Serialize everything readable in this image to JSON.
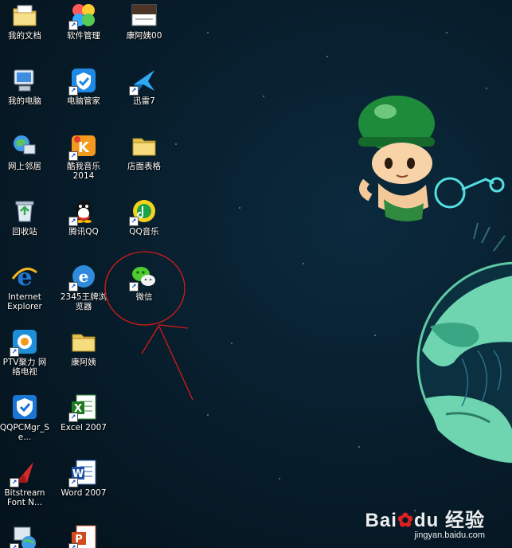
{
  "desktop": {
    "icons": [
      {
        "label": "我的文档",
        "icon": "my-documents-folder-icon",
        "shortcut": false
      },
      {
        "label": "软件管理",
        "icon": "software-manager-icon",
        "shortcut": true
      },
      {
        "label": "康阿姨00",
        "icon": "document-thumbnail-icon",
        "shortcut": false
      },
      {
        "label": "我的电脑",
        "icon": "my-computer-icon",
        "shortcut": false
      },
      {
        "label": "电脑管家",
        "icon": "pc-manager-shield-icon",
        "shortcut": true
      },
      {
        "label": "迅雷7",
        "icon": "xunlei-bird-icon",
        "shortcut": true
      },
      {
        "label": "网上邻居",
        "icon": "network-places-icon",
        "shortcut": false
      },
      {
        "label": "酷我音乐\n2014",
        "icon": "kuwo-music-icon",
        "shortcut": true
      },
      {
        "label": "店面表格",
        "icon": "folder-icon",
        "shortcut": false
      },
      {
        "label": "回收站",
        "icon": "recycle-bin-icon",
        "shortcut": false
      },
      {
        "label": "腾讯QQ",
        "icon": "qq-penguin-icon",
        "shortcut": true
      },
      {
        "label": "QQ音乐",
        "icon": "qq-music-icon",
        "shortcut": true
      },
      {
        "label": "Internet\nExplorer",
        "icon": "internet-explorer-icon",
        "shortcut": false
      },
      {
        "label": "2345王牌浏\n览器",
        "icon": "browser-2345-icon",
        "shortcut": true
      },
      {
        "label": "微信",
        "icon": "wechat-icon",
        "shortcut": true
      },
      {
        "label": "PTV聚力 网\n络电视",
        "icon": "pptv-icon",
        "shortcut": true
      },
      {
        "label": "康阿姨",
        "icon": "folder-icon",
        "shortcut": false
      },
      {
        "label": "QQPCMgr_Se...",
        "icon": "qqpcmgr-shield-icon",
        "shortcut": false
      },
      {
        "label": "Excel 2007",
        "icon": "excel-icon",
        "shortcut": true
      },
      {
        "label": "Bitstream\nFont N...",
        "icon": "bitstream-font-icon",
        "shortcut": true
      },
      {
        "label": "Word 2007",
        "icon": "word-icon",
        "shortcut": true
      },
      {
        "label": "",
        "icon": "network-tool-icon",
        "shortcut": true
      },
      {
        "label": "",
        "icon": "powerpoint-icon",
        "shortcut": true
      }
    ]
  },
  "watermark": {
    "brand_bai": "Bai",
    "brand_du": "du",
    "brand_jingyan": "经验",
    "url": "jingyan.baidu.com"
  },
  "colors": {
    "background": "#071c2a",
    "annotation": "#d41a1a",
    "helmet": "#1e8b3a",
    "planet": "#6ed5b0"
  }
}
